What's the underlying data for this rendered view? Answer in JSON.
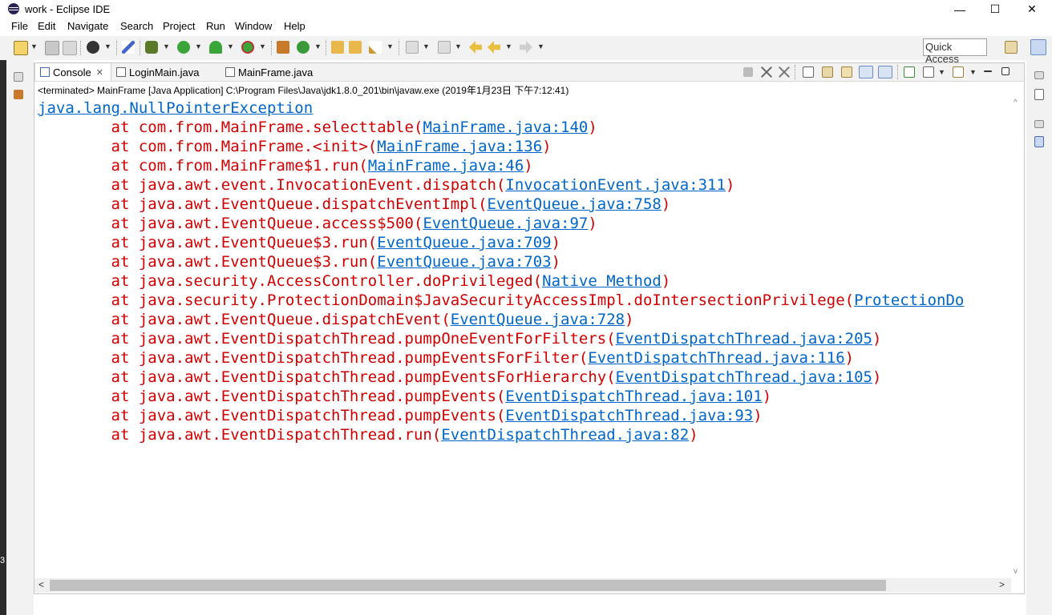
{
  "window": {
    "title": "work - Eclipse IDE",
    "controls": {
      "minimize": "—",
      "maximize": "☐",
      "close": "✕"
    }
  },
  "menu": [
    "File",
    "Edit",
    "Navigate",
    "Search",
    "Project",
    "Run",
    "Window",
    "Help"
  ],
  "toolbar": {
    "quick_access": "Quick Access",
    "accent_colors": {
      "run": "#3aa63a",
      "debug": "#5a7a2a"
    }
  },
  "tabs": [
    {
      "label": "Console",
      "active": true,
      "close": "✕",
      "icon": "console-icon"
    },
    {
      "label": "LoginMain.java",
      "active": false,
      "icon": "java-file-icon"
    },
    {
      "label": "MainFrame.java",
      "active": false,
      "icon": "java-file-icon"
    }
  ],
  "console": {
    "status": "<terminated> MainFrame [Java Application] C:\\Program Files\\Java\\jdk1.8.0_201\\bin\\javaw.exe (2019年1月23日 下午7:12:41)",
    "exception": "java.lang.NullPointerException",
    "frames": [
      {
        "text": "\tat com.from.MainFrame.selecttable(",
        "link": "MainFrame.java:140",
        "close": ")"
      },
      {
        "text": "\tat com.from.MainFrame.<init>(",
        "link": "MainFrame.java:136",
        "close": ")"
      },
      {
        "text": "\tat com.from.MainFrame$1.run(",
        "link": "MainFrame.java:46",
        "close": ")"
      },
      {
        "text": "\tat java.awt.event.InvocationEvent.dispatch(",
        "link": "InvocationEvent.java:311",
        "close": ")"
      },
      {
        "text": "\tat java.awt.EventQueue.dispatchEventImpl(",
        "link": "EventQueue.java:758",
        "close": ")"
      },
      {
        "text": "\tat java.awt.EventQueue.access$500(",
        "link": "EventQueue.java:97",
        "close": ")"
      },
      {
        "text": "\tat java.awt.EventQueue$3.run(",
        "link": "EventQueue.java:709",
        "close": ")"
      },
      {
        "text": "\tat java.awt.EventQueue$3.run(",
        "link": "EventQueue.java:703",
        "close": ")"
      },
      {
        "text": "\tat java.security.AccessController.doPrivileged(",
        "link": "Native Method",
        "close": ")"
      },
      {
        "text": "\tat java.security.ProtectionDomain$JavaSecurityAccessImpl.doIntersectionPrivilege(",
        "link": "ProtectionDo",
        "close": ""
      },
      {
        "text": "\tat java.awt.EventQueue.dispatchEvent(",
        "link": "EventQueue.java:728",
        "close": ")"
      },
      {
        "text": "\tat java.awt.EventDispatchThread.pumpOneEventForFilters(",
        "link": "EventDispatchThread.java:205",
        "close": ")"
      },
      {
        "text": "\tat java.awt.EventDispatchThread.pumpEventsForFilter(",
        "link": "EventDispatchThread.java:116",
        "close": ")"
      },
      {
        "text": "\tat java.awt.EventDispatchThread.pumpEventsForHierarchy(",
        "link": "EventDispatchThread.java:105",
        "close": ")"
      },
      {
        "text": "\tat java.awt.EventDispatchThread.pumpEvents(",
        "link": "EventDispatchThread.java:101",
        "close": ")"
      },
      {
        "text": "\tat java.awt.EventDispatchThread.pumpEvents(",
        "link": "EventDispatchThread.java:93",
        "close": ")"
      },
      {
        "text": "\tat java.awt.EventDispatchThread.run(",
        "link": "EventDispatchThread.java:82",
        "close": ")"
      }
    ]
  },
  "left_strip": {
    "label": "3"
  },
  "scrollbar": {
    "left_arrow": "<",
    "right_arrow": ">",
    "up_arrow": "^",
    "down_arrow": "v"
  }
}
